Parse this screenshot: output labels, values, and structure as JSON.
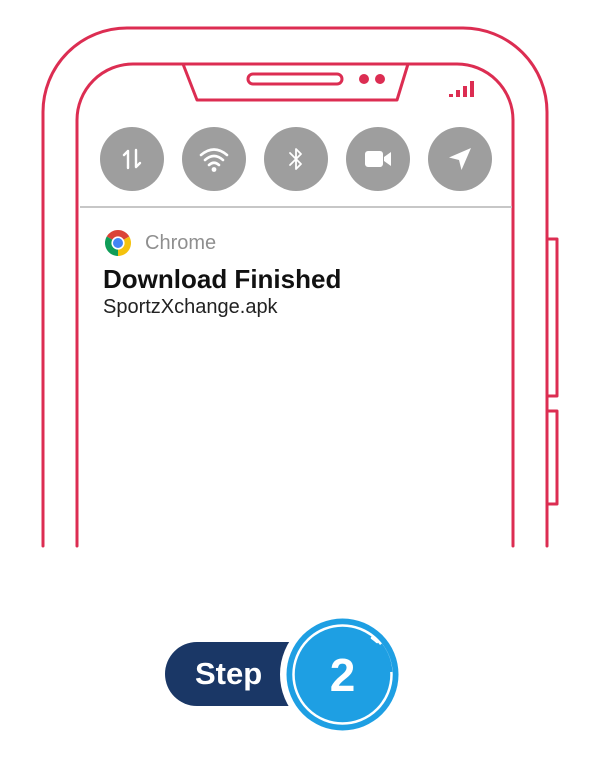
{
  "colors": {
    "phone_outline": "#dc2d52",
    "qs_button": "#9e9e9e",
    "step_pill": "#1a3766",
    "step_circle": "#1e9fe3"
  },
  "status_bar": {
    "signal_icon": "signal-bars-icon",
    "camera_dots_icon": "camera-dots-icon",
    "speaker_icon": "speaker-slot-icon"
  },
  "quick_settings": [
    {
      "icon": "data-transfer-icon"
    },
    {
      "icon": "wifi-icon"
    },
    {
      "icon": "bluetooth-icon"
    },
    {
      "icon": "video-camera-icon"
    },
    {
      "icon": "location-arrow-icon"
    }
  ],
  "notification": {
    "app_icon": "chrome-icon",
    "app_name": "Chrome",
    "title": "Download Finished",
    "body": "SportzXchange.apk"
  },
  "step": {
    "label": "Step",
    "number": "2"
  }
}
